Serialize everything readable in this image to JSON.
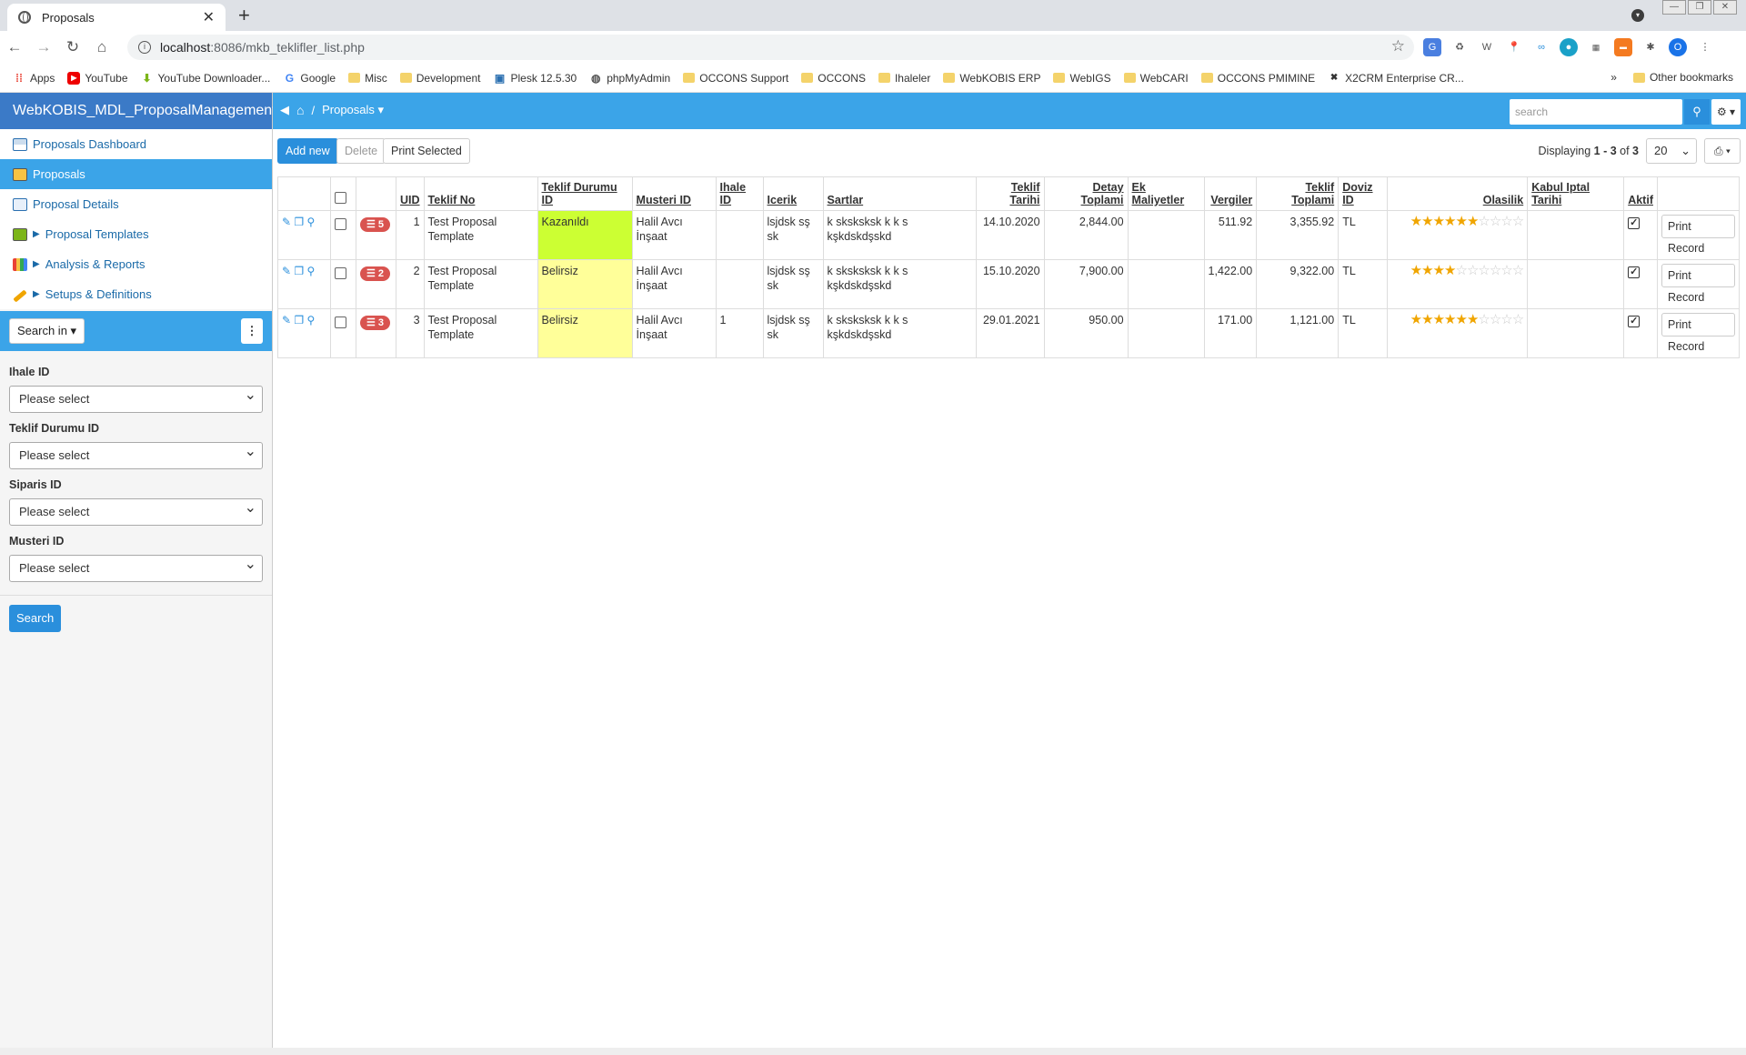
{
  "browser": {
    "tab_title": "Proposals",
    "url_host": "localhost",
    "url_rest": ":8086/mkb_teklifler_list.php",
    "profile_initial": "O",
    "bookmarks": [
      "Apps",
      "YouTube",
      "YouTube Downloader...",
      "Google",
      "Misc",
      "Development",
      "Plesk 12.5.30",
      "phpMyAdmin",
      "OCCONS Support",
      "OCCONS",
      "Ihaleler",
      "WebKOBIS ERP",
      "WebIGS",
      "WebCARI",
      "OCCONS PMIMINE",
      "X2CRM Enterprise CR..."
    ],
    "more_bookmarks": "»",
    "other_bookmarks": "Other bookmarks"
  },
  "sidebar": {
    "app_name": "WebKOBIS_MDL_ProposalManagement",
    "menu": [
      "Proposals Dashboard",
      "Proposals",
      "Proposal Details",
      "Proposal Templates",
      "Analysis & Reports",
      "Setups & Definitions"
    ],
    "search_in": "Search in ▾",
    "filters": [
      {
        "label": "Ihale ID",
        "value": "Please select"
      },
      {
        "label": "Teklif Durumu ID",
        "value": "Please select"
      },
      {
        "label": "Siparis ID",
        "value": "Please select"
      },
      {
        "label": "Musteri ID",
        "value": "Please select"
      }
    ],
    "search_button": "Search"
  },
  "topbar": {
    "breadcrumb_sep": "/",
    "breadcrumb": "Proposals ▾",
    "search_placeholder": "search"
  },
  "toolbar": {
    "add_new": "Add new",
    "delete": "Delete",
    "print_selected": "Print Selected",
    "displaying_prefix": "Displaying ",
    "displaying_range": "1 - 3",
    "displaying_of": " of ",
    "displaying_total": "3",
    "page_size": "20"
  },
  "table": {
    "headers": [
      "UID",
      "Teklif No",
      "Teklif Durumu ID",
      "Musteri ID",
      "Ihale ID",
      "Icerik",
      "Sartlar",
      "Teklif Tarihi",
      "Detay Toplami",
      "Ek Maliyetler",
      "Vergiler",
      "Teklif Toplami",
      "Doviz ID",
      "Olasilik",
      "Kabul Iptal Tarihi",
      "Aktif"
    ],
    "rows": [
      {
        "badge": "5",
        "uid": "1",
        "teklif_no": "Test Proposal Template",
        "durum": "Kazanıldı",
        "musteri": "Halil Avcı İnşaat",
        "ihale": "",
        "icerik": "lsjdsk sş sk",
        "sartlar": "k sksksksk k k s kşkdskdşskd",
        "tarih": "14.10.2020",
        "detay": "2,844.00",
        "ek": "",
        "vergiler": "511.92",
        "toplam": "3,355.92",
        "doviz": "TL",
        "olasilik": 6,
        "kabul": "",
        "print": "Print Record"
      },
      {
        "badge": "2",
        "uid": "2",
        "teklif_no": "Test Proposal Template",
        "durum": "Belirsiz",
        "musteri": "Halil Avcı İnşaat",
        "ihale": "",
        "icerik": "lsjdsk sş sk",
        "sartlar": "k sksksksk k k s kşkdskdşskd",
        "tarih": "15.10.2020",
        "detay": "7,900.00",
        "ek": "",
        "vergiler": "1,422.00",
        "toplam": "9,322.00",
        "doviz": "TL",
        "olasilik": 4,
        "kabul": "",
        "print": "Print Record"
      },
      {
        "badge": "3",
        "uid": "3",
        "teklif_no": "Test Proposal Template",
        "durum": "Belirsiz",
        "musteri": "Halil Avcı İnşaat",
        "ihale": "1",
        "icerik": "lsjdsk sş sk",
        "sartlar": "k sksksksk k k s kşkdskdşskd",
        "tarih": "29.01.2021",
        "detay": "950.00",
        "ek": "",
        "vergiler": "171.00",
        "toplam": "1,121.00",
        "doviz": "TL",
        "olasilik": 6,
        "kabul": "",
        "print": "Print Record"
      }
    ],
    "stars_max": 10
  },
  "colors": {
    "accent": "#3ba4e8",
    "header": "#3b7ac7",
    "status_won": "#ccff33",
    "status_unknown": "#ffff99",
    "badge": "#d9534f"
  }
}
